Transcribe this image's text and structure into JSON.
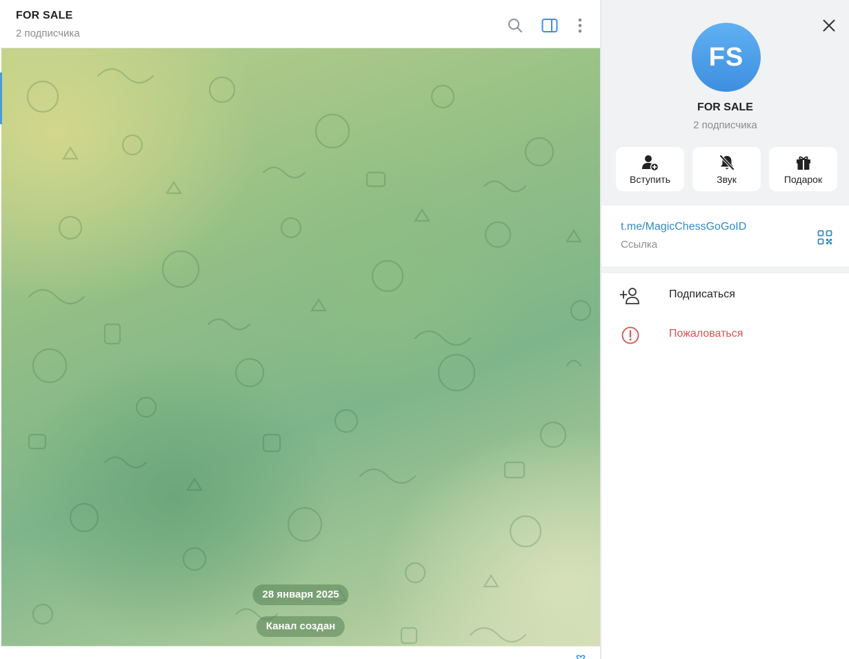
{
  "chat": {
    "title": "FOR SALE",
    "subtitle": "2 подписчика",
    "date_pill": "28 января 2025",
    "service_message": "Канал создан"
  },
  "panel": {
    "avatar_initials": "FS",
    "title": "FOR SALE",
    "subtitle": "2 подписчика",
    "actions": [
      {
        "label": "Вступить",
        "icon": "add-user-icon"
      },
      {
        "label": "Звук",
        "icon": "bell-muted-icon"
      },
      {
        "label": "Подарок",
        "icon": "gift-icon"
      }
    ],
    "link": {
      "url": "t.me/MagicChessGoGoID",
      "label": "Ссылка"
    },
    "menu": [
      {
        "label": "Подписаться",
        "icon": "add-person-icon"
      },
      {
        "label": "Пожаловаться",
        "icon": "alert-circle-icon"
      }
    ]
  },
  "colors": {
    "accent": "#2f8ac8",
    "avatar_top": "#5fb1f2",
    "avatar_bottom": "#3e8ee0",
    "danger": "#d9534f",
    "panel_bg": "#f1f2f4"
  }
}
